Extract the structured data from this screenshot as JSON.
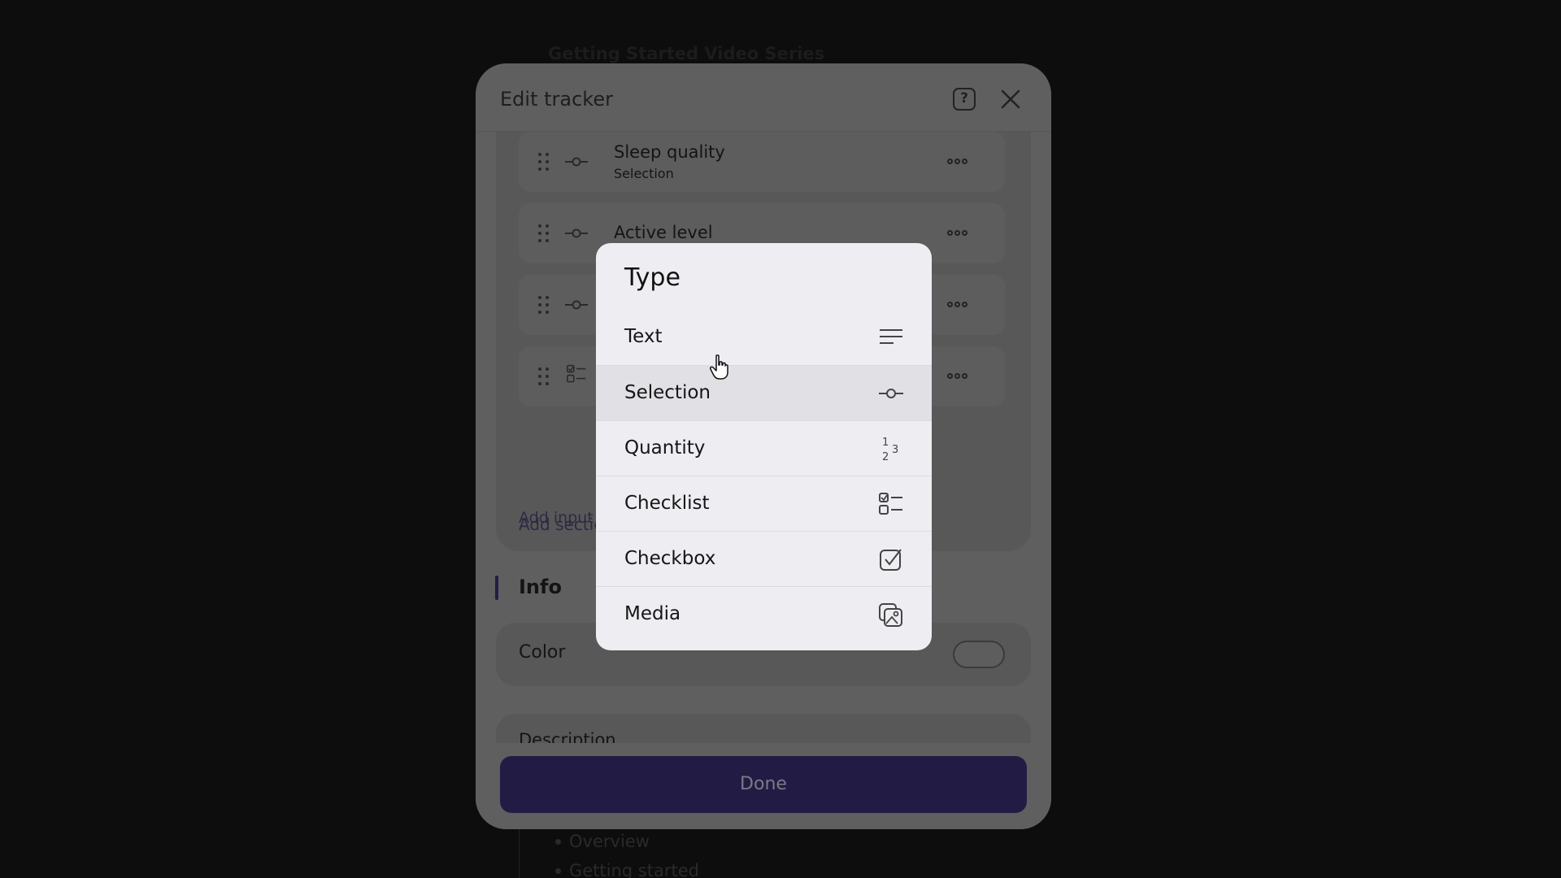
{
  "background": {
    "title": "Getting Started Video Series",
    "list_items": [
      "Overview",
      "Getting started"
    ]
  },
  "dialog": {
    "title": "Edit tracker",
    "help_icon": "question-icon",
    "help_glyph": "?",
    "close_icon": "close-icon",
    "inputs": [
      {
        "name": "Sleep quality",
        "type": "Selection",
        "icon": "selection-icon"
      },
      {
        "name": "Active level",
        "type": "",
        "icon": "selection-icon"
      },
      {
        "name": "",
        "type": "",
        "icon": "selection-icon"
      },
      {
        "name": "",
        "type": "",
        "icon": "checklist-icon"
      }
    ],
    "add_input_label": "Add input",
    "add_section_label": "Add section",
    "info_heading": "Info",
    "color_label": "Color",
    "description_label": "Description",
    "done_label": "Done"
  },
  "type_popup": {
    "title": "Type",
    "selected": "Selection",
    "options": [
      {
        "label": "Text",
        "icon": "text-lines-icon"
      },
      {
        "label": "Selection",
        "icon": "slider-icon"
      },
      {
        "label": "Quantity",
        "icon": "number-123-icon"
      },
      {
        "label": "Checklist",
        "icon": "checklist-icon"
      },
      {
        "label": "Checkbox",
        "icon": "checkbox-icon"
      },
      {
        "label": "Media",
        "icon": "media-icon"
      }
    ]
  },
  "colors": {
    "accent": "#221c45",
    "popup_bg": "#eeedf2",
    "selected_row_bg": "#e1e0e5"
  }
}
